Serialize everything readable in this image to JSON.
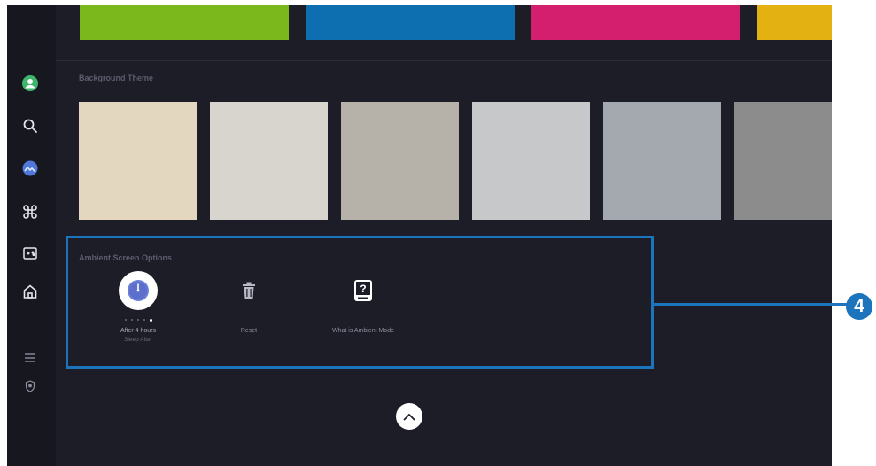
{
  "colors": {
    "screen_bg": "#1d1d28",
    "sidebar_bg": "#171720",
    "accent": "#1c75bc",
    "color_tiles": [
      "#7bb81b",
      "#0e6fb0",
      "#d41f6f",
      "#e4b112"
    ],
    "background_tiles": [
      "#e3d7bf",
      "#d8d5cf",
      "#b6b1a9",
      "#c7c8c9",
      "#a4a9b0",
      "#8c8c8c"
    ]
  },
  "sidebar": {
    "items": [
      {
        "icon": "profile-icon"
      },
      {
        "icon": "search-icon"
      },
      {
        "icon": "ambient-icon"
      },
      {
        "icon": "apps-icon"
      },
      {
        "icon": "game-icon"
      },
      {
        "icon": "home-icon"
      },
      {
        "icon": "menu-icon"
      },
      {
        "icon": "privacy-icon"
      }
    ]
  },
  "sections": {
    "background_theme": "Background Theme",
    "ambient_options": "Ambient Screen Options"
  },
  "options": [
    {
      "label": "After 4 hours",
      "sublabel": "Sleep After",
      "icon": "clock-icon"
    },
    {
      "label": "Reset",
      "icon": "trash-icon"
    },
    {
      "label": "What is Ambient Mode",
      "icon": "help-book-icon"
    }
  ],
  "sleep_after_dots": {
    "count": 5,
    "selected": 5
  },
  "callout": {
    "number": "4"
  }
}
